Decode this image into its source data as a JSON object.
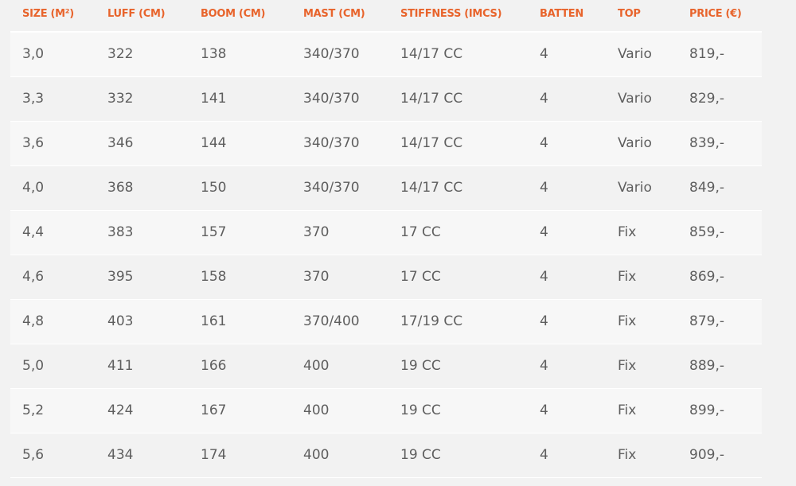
{
  "table": {
    "headers": [
      "SIZE (M²)",
      "LUFF (CM)",
      "BOOM (CM)",
      "MAST (CM)",
      "STIFFNESS (IMCS)",
      "BATTEN",
      "TOP",
      "PRICE (€)"
    ],
    "rows": [
      [
        "3,0",
        "322",
        "138",
        "340/370",
        "14/17 CC",
        "4",
        "Vario",
        "819,-"
      ],
      [
        "3,3",
        "332",
        "141",
        "340/370",
        "14/17 CC",
        "4",
        "Vario",
        "829,-"
      ],
      [
        "3,6",
        "346",
        "144",
        "340/370",
        "14/17 CC",
        "4",
        "Vario",
        "839,-"
      ],
      [
        "4,0",
        "368",
        "150",
        "340/370",
        "14/17 CC",
        "4",
        "Vario",
        "849,-"
      ],
      [
        "4,4",
        "383",
        "157",
        "370",
        "17 CC",
        "4",
        "Fix",
        "859,-"
      ],
      [
        "4,6",
        "395",
        "158",
        "370",
        "17 CC",
        "4",
        "Fix",
        "869,-"
      ],
      [
        "4,8",
        "403",
        "161",
        "370/400",
        "17/19 CC",
        "4",
        "Fix",
        "879,-"
      ],
      [
        "5,0",
        "411",
        "166",
        "400",
        "19 CC",
        "4",
        "Fix",
        "889,-"
      ],
      [
        "5,2",
        "424",
        "167",
        "400",
        "19 CC",
        "4",
        "Fix",
        "899,-"
      ],
      [
        "5,6",
        "434",
        "174",
        "400",
        "19 CC",
        "4",
        "Fix",
        "909,-"
      ]
    ]
  },
  "colors": {
    "header_text": "#e8642c",
    "cell_text": "#5e5e5e",
    "row_light": "#f7f7f7",
    "row_dark": "#f2f2f2"
  }
}
